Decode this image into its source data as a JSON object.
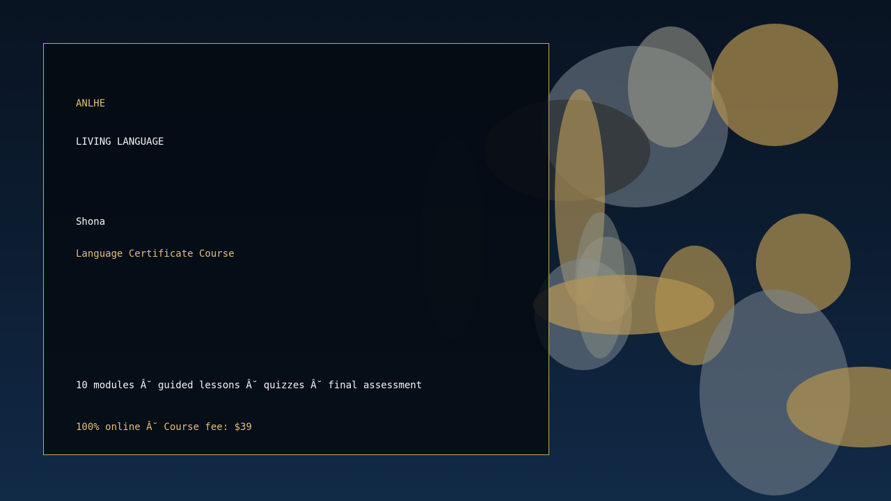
{
  "brand": "ANLHE",
  "kicker": "LIVING LANGUAGE",
  "language": "Shona",
  "course_title": "Language Certificate Course",
  "features": "10 modules Â˘ guided lessons Â˘ quizzes Â˘ final assessment",
  "pricing": "100% online Â˘ Course fee: $39",
  "colors": {
    "background_top": "#091322",
    "background_bottom": "#112a46",
    "accent_gold": "#e2bf78",
    "panel_border": "#c7a86a",
    "text_white": "#f4f4f4"
  }
}
